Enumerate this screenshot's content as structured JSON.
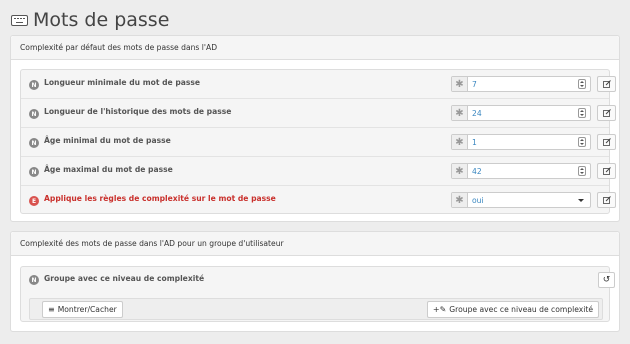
{
  "page": {
    "title": "Mots de passe",
    "icon": "keyboard-icon"
  },
  "default_section": {
    "heading": "Complexité par défaut des mots de passe dans l'AD",
    "rows": [
      {
        "badge": "N",
        "label": "Longueur minimale du mot de passe",
        "value": "7",
        "control": "number"
      },
      {
        "badge": "N",
        "label": "Longueur de l'historique des mots de passe",
        "value": "24",
        "control": "number"
      },
      {
        "badge": "N",
        "label": "Âge minimal du mot de passe",
        "value": "1",
        "control": "number"
      },
      {
        "badge": "N",
        "label": "Âge maximal du mot de passe",
        "value": "42",
        "control": "number"
      },
      {
        "badge": "E",
        "label": "Applique les règles de complexité sur le mot de passe",
        "value": "oui",
        "control": "select",
        "status_color": "#d9534f"
      }
    ]
  },
  "group_section": {
    "heading": "Complexité des mots de passe dans l'AD pour un groupe d'utilisateur",
    "group_label": "Groupe avec ce niveau de complexité",
    "badge": "N",
    "toggle_label": "Montrer/Cacher",
    "add_label": "Groupe avec ce niveau de complexité"
  },
  "colors": {
    "value_text": "#3a87c0",
    "error": "#c9302c"
  }
}
